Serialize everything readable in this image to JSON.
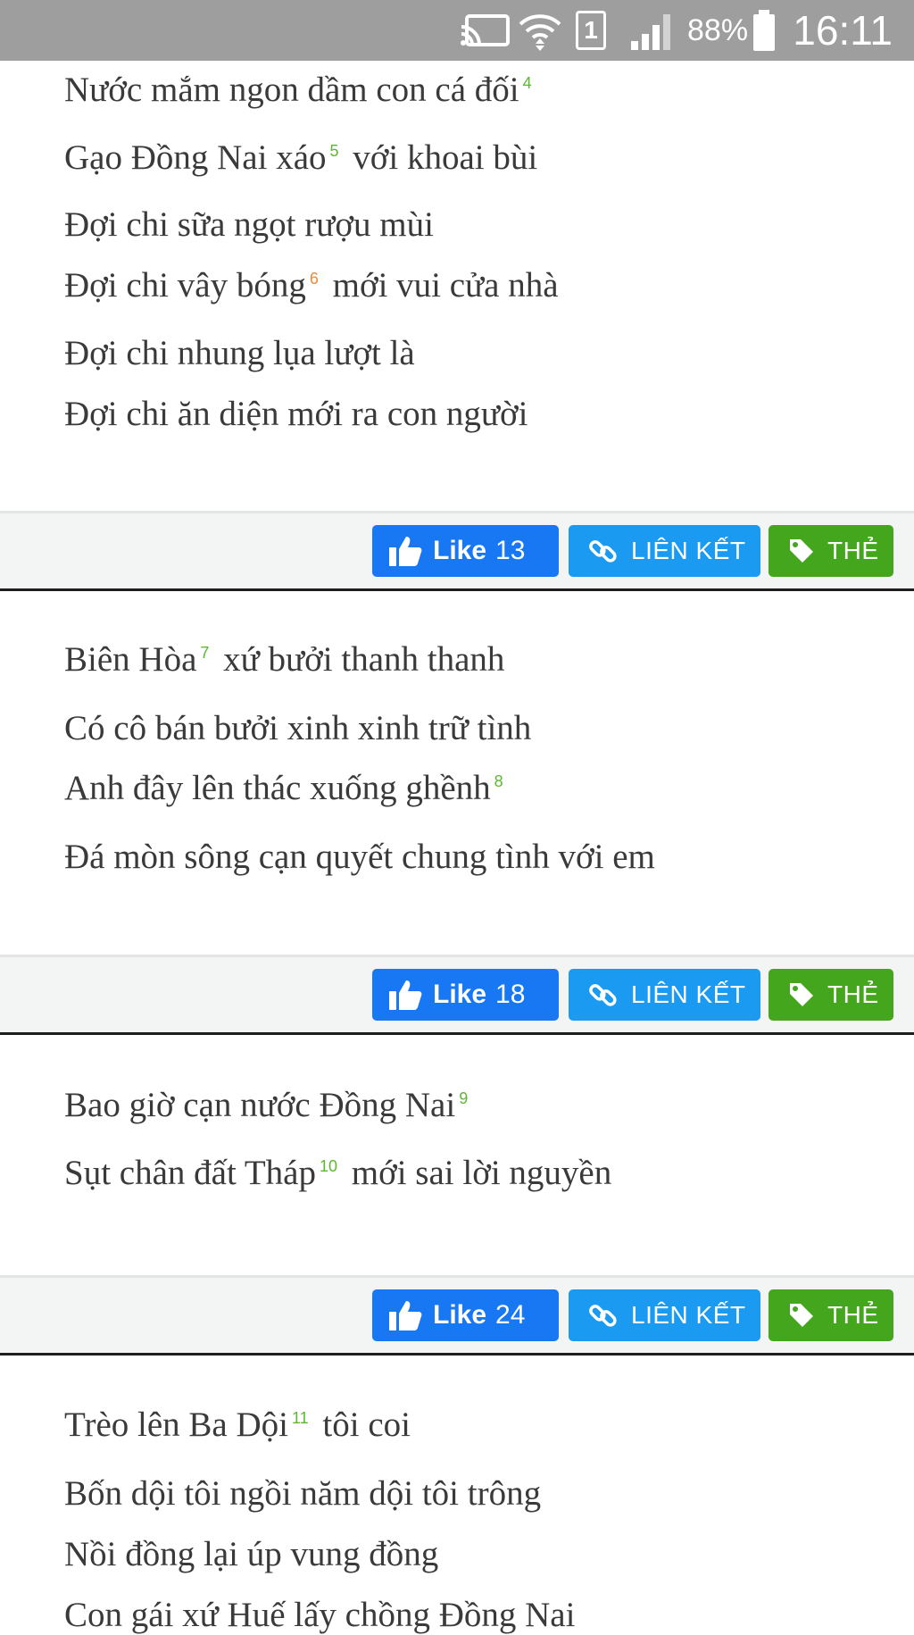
{
  "status_bar": {
    "battery": "88%",
    "time": "16:11",
    "sim_slot": "1",
    "icons": [
      "cast-icon",
      "wifi-icon",
      "sim-icon",
      "signal-icon",
      "battery-icon"
    ]
  },
  "poems": [
    {
      "lines": [
        {
          "text": "Nước mắm ngon dầm con cá đối",
          "fn": "4"
        },
        {
          "pre": "Gạo Đồng Nai xáo",
          "fn": "5",
          "post": "với khoai bùi"
        },
        {
          "text": "Đợi chi sữa ngọt rượu mùi"
        },
        {
          "pre": "Đợi chi vây bóng",
          "fn": "6",
          "post": "mới vui cửa nhà"
        },
        {
          "text": "Đợi chi nhung lụa lượt là"
        },
        {
          "text": "Đợi chi ăn diện mới ra con người"
        }
      ],
      "actions": {
        "like_label": "Like",
        "like_count": "13",
        "link_label": "LIÊN KẾT",
        "tag_label": "THẺ"
      }
    },
    {
      "lines": [
        {
          "pre": "Biên Hòa",
          "fn": "7",
          "post": "xứ bưởi thanh thanh"
        },
        {
          "text": "Có cô bán bưởi xinh xinh trữ tình"
        },
        {
          "text": "Anh đây lên thác xuống ghềnh",
          "fn": "8"
        },
        {
          "text": "Đá mòn sông cạn quyết chung tình với em"
        }
      ],
      "actions": {
        "like_label": "Like",
        "like_count": "18",
        "link_label": "LIÊN KẾT",
        "tag_label": "THẺ"
      }
    },
    {
      "lines": [
        {
          "text": "Bao giờ cạn nước Đồng Nai",
          "fn": "9"
        },
        {
          "pre": "Sụt chân đất Tháp",
          "fn": "10",
          "post": "mới sai lời nguyền"
        }
      ],
      "actions": {
        "like_label": "Like",
        "like_count": "24",
        "link_label": "LIÊN KẾT",
        "tag_label": "THẺ"
      }
    },
    {
      "lines": [
        {
          "pre": "Trèo lên Ba Dội",
          "fn": "11",
          "post": "tôi coi"
        },
        {
          "text": "Bốn dội tôi ngồi năm dội tôi trông"
        },
        {
          "text": "Nồi đồng lại úp vung đồng"
        },
        {
          "text": "Con gái xứ Huế lấy chồng Đồng Nai"
        }
      ]
    }
  ],
  "colors": {
    "footnote_green": "#5cb82f",
    "footnote_orange": "#e88a3c",
    "like_blue": "#1877f2",
    "link_blue": "#1a9af0",
    "tag_green": "#44a61d",
    "status_bar_gray": "#9e9e9e"
  }
}
